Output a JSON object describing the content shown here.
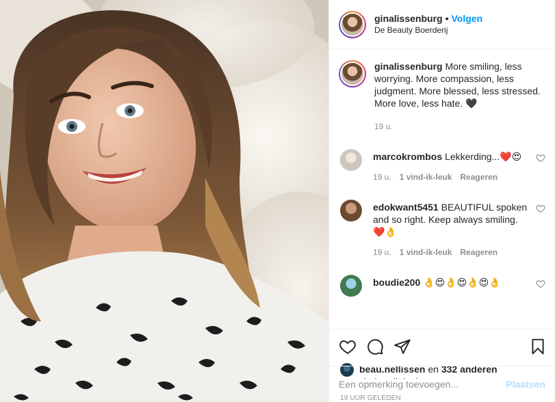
{
  "header": {
    "username": "ginalissenburg",
    "separator": "•",
    "follow_label": "Volgen",
    "location": "De Beauty Boerderij"
  },
  "caption": {
    "username": "ginalissenburg",
    "text": "More smiling, less worrying. More compassion, less judgment. More blessed, less stressed. More love, less hate. 🖤",
    "time": "19 u."
  },
  "comments": [
    {
      "username": "marcokrombos",
      "text": "Lekkerding...❤️😍",
      "time": "19 u.",
      "likes": "1 vind-ik-leuk",
      "reply": "Reageren",
      "avatar_color": "#d9d4cf"
    },
    {
      "username": "edokwant5451",
      "text": "BEAUTIFUL spoken and so right. Keep always smiling. ❤️👌",
      "time": "19 u.",
      "likes": "1 vind-ik-leuk",
      "reply": "Reageren",
      "avatar_color": "#9a6a4a"
    },
    {
      "username": "boudie200",
      "text": "👌😍👌😍👌😍👌",
      "time": "",
      "likes": "",
      "reply": "",
      "avatar_color": "#5a8fb0"
    }
  ],
  "actions": {
    "icons": [
      "heart-icon",
      "comment-icon",
      "share-icon",
      "bookmark-icon"
    ]
  },
  "likes": {
    "user": "beau.nellissen",
    "connector": "en",
    "others": "332 anderen",
    "suffix": "vinden dit leuk"
  },
  "timestamp": "19 UUR GELEDEN",
  "add_comment": {
    "placeholder": "Een opmerking toevoegen...",
    "post_label": "Plaatsen"
  },
  "colors": {
    "accent_blue": "#0095f6",
    "post_disabled": "#b2dffc",
    "muted": "#8e8e8e",
    "border": "#efefef"
  }
}
